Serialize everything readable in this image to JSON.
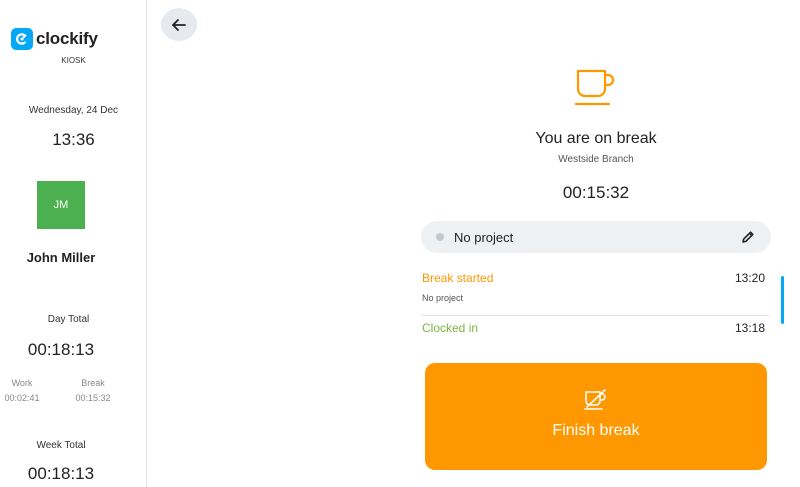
{
  "sidebar": {
    "brand": "clockify",
    "subtitle": "KIOSK",
    "date": "Wednesday, 24 Dec",
    "time": "13:36",
    "avatar_initials": "JM",
    "avatar_color": "#4caf50",
    "user_name": "John Miller",
    "day_total_label": "Day Total",
    "day_total_value": "00:18:13",
    "work_label": "Work",
    "work_value": "00:02:41",
    "break_label": "Break",
    "break_value": "00:15:32",
    "week_total_label": "Week Total",
    "week_total_value": "00:18:13"
  },
  "header": {
    "back_icon": "arrow-left-icon"
  },
  "main": {
    "status_icon": "coffee-cup-icon",
    "status_title": "You are on break",
    "branch": "Westside Branch",
    "timer": "00:15:32",
    "project_label": "No project",
    "edit_icon": "pencil-icon",
    "entries": [
      {
        "name": "Break started",
        "time": "13:20",
        "subtitle": "No project",
        "color": "#ff9800"
      },
      {
        "name": "Clocked in",
        "time": "13:18",
        "subtitle": "",
        "color": "#7cb342"
      }
    ],
    "finish_icon": "no-coffee-icon",
    "finish_label": "Finish break"
  },
  "colors": {
    "accent": "#03a9f4",
    "break": "#ff9800",
    "clocked_in": "#7cb342"
  }
}
